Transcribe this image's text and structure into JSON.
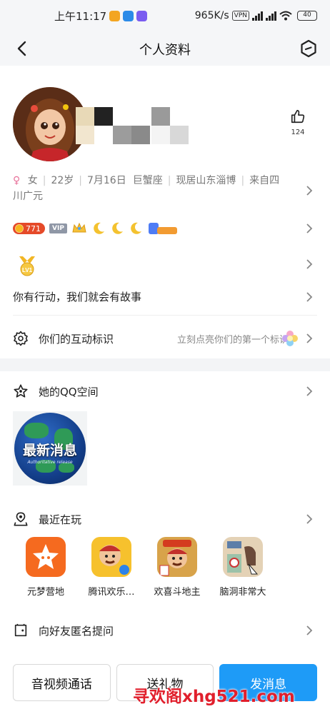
{
  "status_bar": {
    "time": "上午11:17",
    "network_speed": "965K/s",
    "vpn": "VPN",
    "battery": "40"
  },
  "nav": {
    "title": "个人资料"
  },
  "profile": {
    "likes": "124",
    "gender_symbol": "♀",
    "gender": "女",
    "age": "22岁",
    "birthday": "7月16日",
    "zodiac": "巨蟹座",
    "location": "现居山东淄博",
    "hometown_line1": "来自四",
    "hometown_line2": "川广元",
    "coin_count": "771",
    "vip_label": "VIP",
    "level_badge": "LV1",
    "signature": "你有行动，我们就会有故事",
    "interaction_label": "你们的互动标识",
    "interaction_hint": "立刻点亮你们的第一个标识"
  },
  "qzone": {
    "title": "她的QQ空间",
    "cover_text": "最新消息",
    "cover_subtext": "Authoritative release"
  },
  "recent_games": {
    "title": "最近在玩",
    "items": [
      {
        "name": "元梦营地"
      },
      {
        "name": "腾讯欢乐…"
      },
      {
        "name": "欢喜斗地主"
      },
      {
        "name": "脑洞非常大"
      }
    ]
  },
  "anon_question": {
    "label": "向好友匿名提问"
  },
  "actions": {
    "call": "音视频通话",
    "gift": "送礼物",
    "message": "发消息"
  },
  "watermark": "寻欢阁xhg521.com",
  "colors": {
    "primary_blue": "#1e9bf7",
    "coin_red": "#e54a29",
    "watermark_red": "#e11f2c"
  }
}
